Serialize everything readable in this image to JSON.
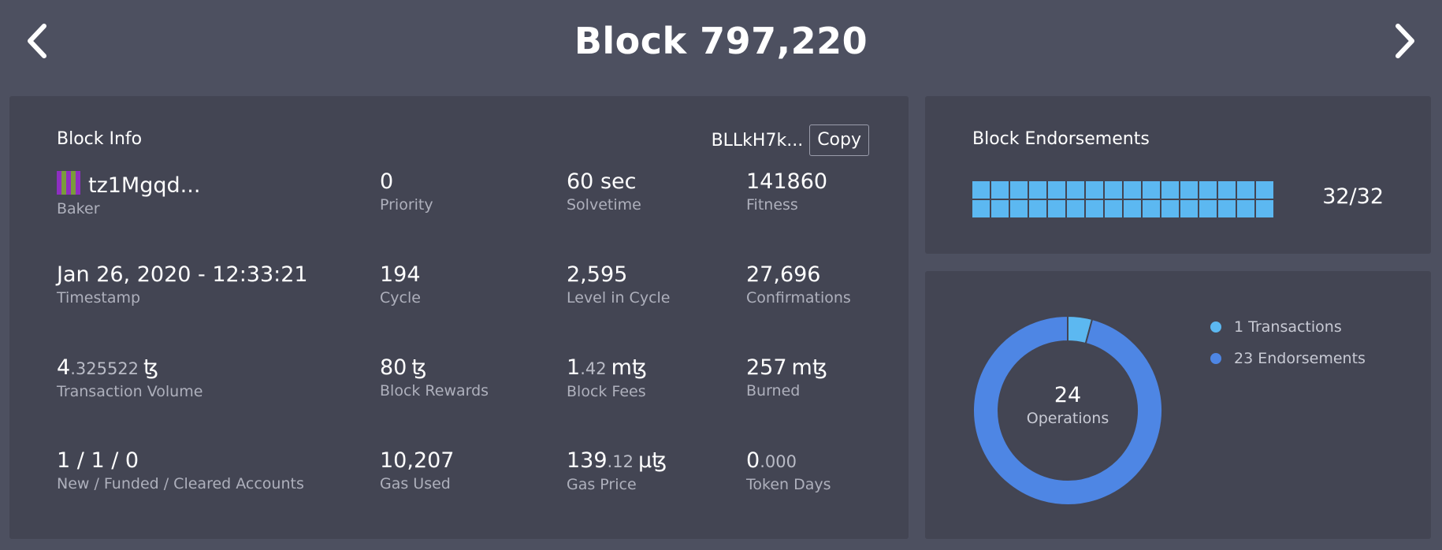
{
  "header": {
    "title": "Block 797,220",
    "prev_icon": "chevron-left-icon",
    "next_icon": "chevron-right-icon"
  },
  "block_info": {
    "title": "Block Info",
    "hash": "BLLkH7k...",
    "copy_label": "Copy",
    "stats": [
      {
        "id": "baker",
        "value": "tz1Mgqd...",
        "label": "Baker",
        "has_avatar": true
      },
      {
        "id": "priority",
        "value": "0",
        "label": "Priority"
      },
      {
        "id": "solvetime",
        "value": "60 sec",
        "label": "Solvetime"
      },
      {
        "id": "fitness",
        "value": "141860",
        "label": "Fitness"
      },
      {
        "id": "timestamp",
        "value": "Jan 26, 2020 - 12:33:21",
        "label": "Timestamp"
      },
      {
        "id": "cycle",
        "value": "194",
        "label": "Cycle"
      },
      {
        "id": "level-in-cycle",
        "value": "2,595",
        "label": "Level in Cycle"
      },
      {
        "id": "confirmations",
        "value": "27,696",
        "label": "Confirmations"
      },
      {
        "id": "transaction-volume",
        "value": "4",
        "decimal": ".325522",
        "unit": "ꜩ",
        "label": "Transaction Volume"
      },
      {
        "id": "block-rewards",
        "value": "80",
        "unit": "ꜩ",
        "label": "Block Rewards"
      },
      {
        "id": "block-fees",
        "value": "1",
        "decimal": ".42",
        "unit": "mꜩ",
        "label": "Block Fees"
      },
      {
        "id": "burned",
        "value": "257",
        "unit": "mꜩ",
        "label": "Burned"
      },
      {
        "id": "accounts",
        "value": "1 / 1 / 0",
        "label": "New / Funded / Cleared Accounts"
      },
      {
        "id": "gas-used",
        "value": "10,207",
        "label": "Gas Used"
      },
      {
        "id": "gas-price",
        "value": "139",
        "decimal": ".12",
        "unit": "μꜩ",
        "label": "Gas Price"
      },
      {
        "id": "token-days",
        "value": "0",
        "decimal": ".000",
        "label": "Token Days"
      }
    ]
  },
  "endorsements": {
    "title": "Block Endorsements",
    "count_text": "32/32",
    "filled": 32,
    "total": 32,
    "color": "#5cb8f1"
  },
  "operations": {
    "total": "24",
    "total_label": "Operations",
    "legend": [
      {
        "label": "1 Transactions",
        "value": 1,
        "color": "#5cb8f1"
      },
      {
        "label": "23 Endorsements",
        "value": 23,
        "color": "#4e86e4"
      }
    ]
  }
}
